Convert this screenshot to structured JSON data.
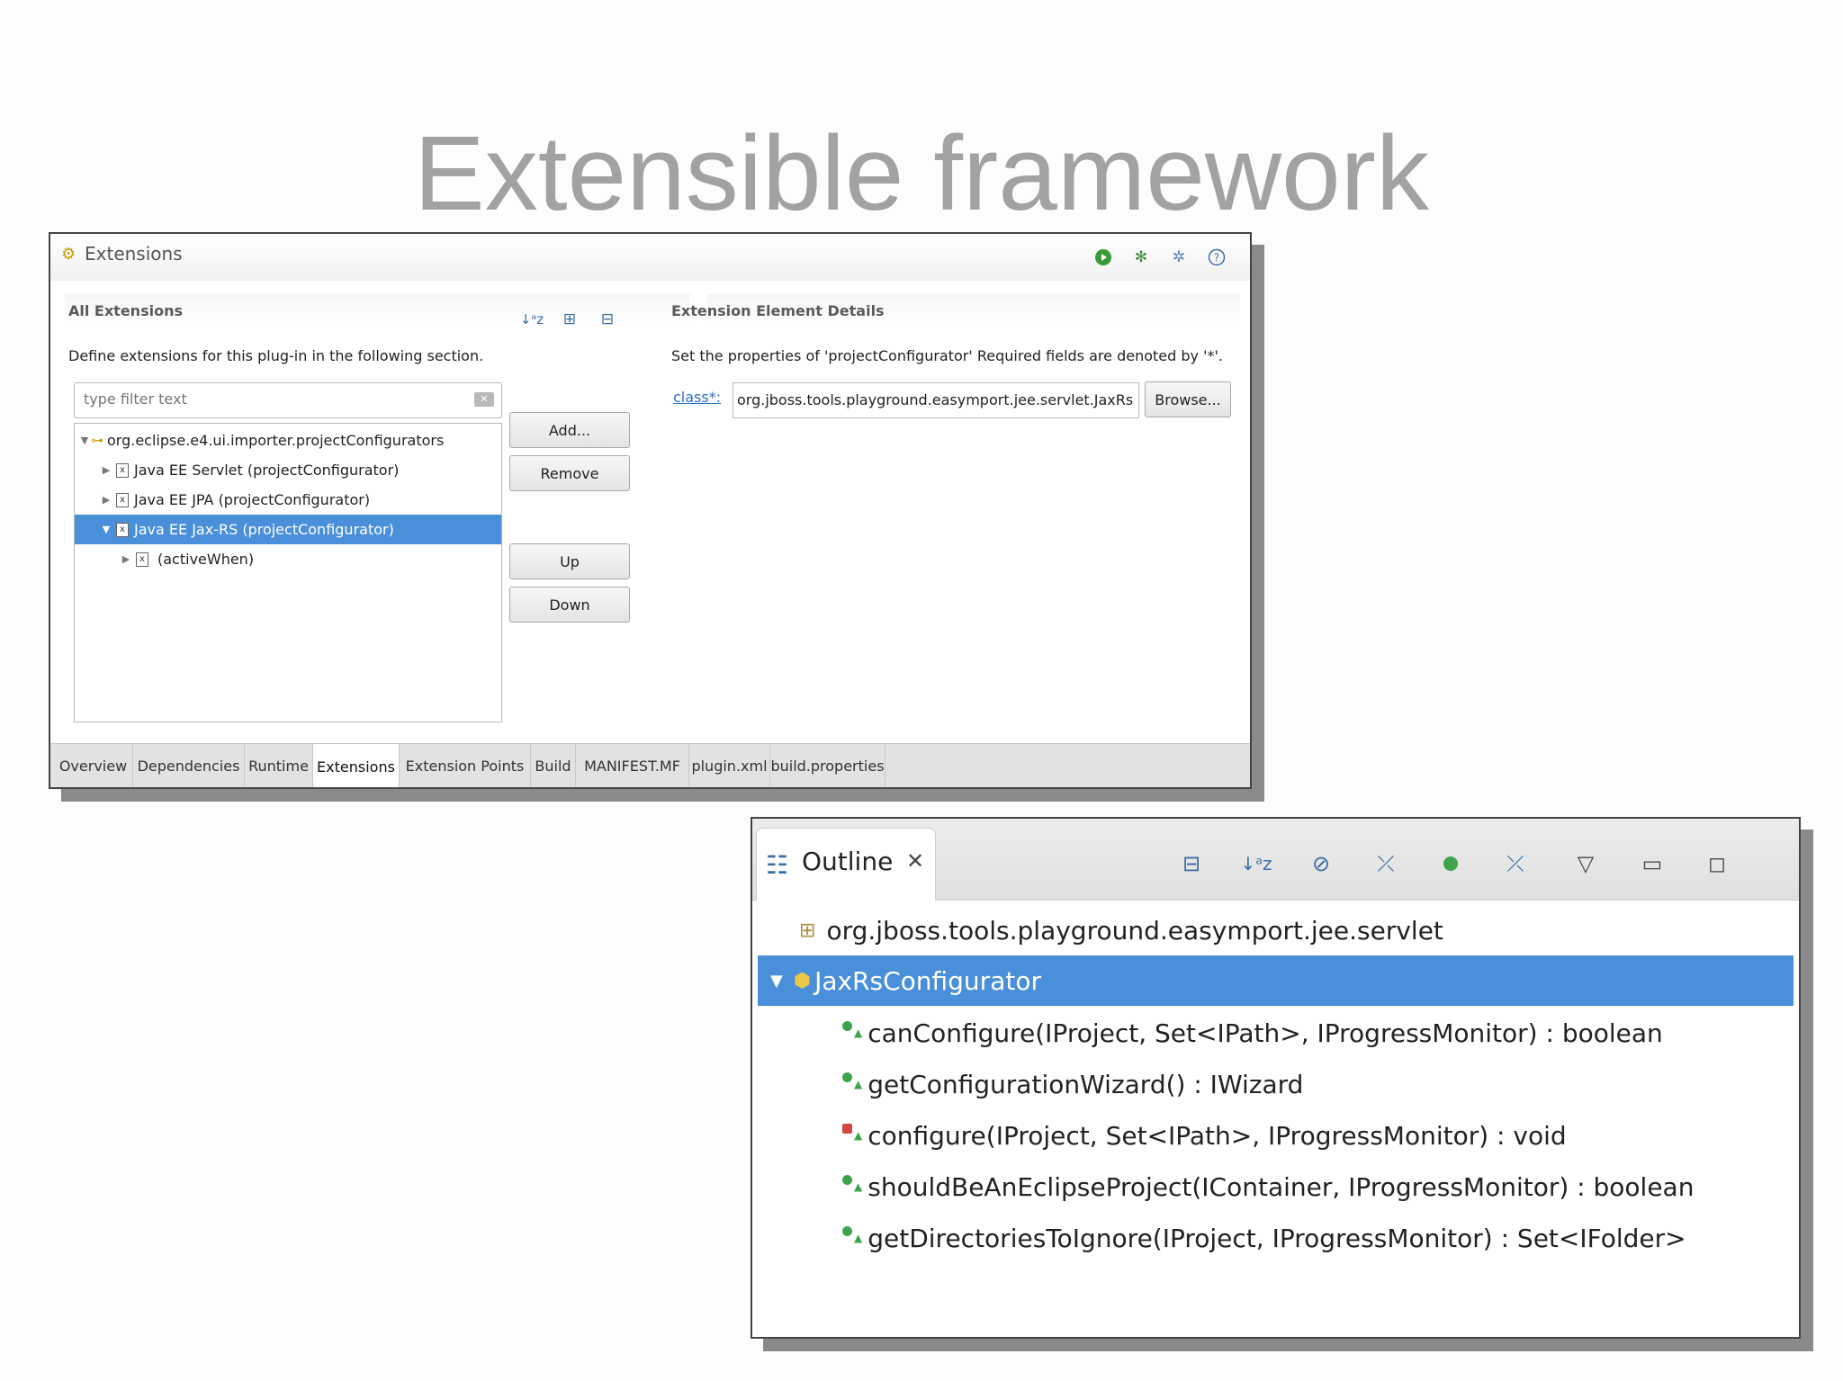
{
  "slide": {
    "title": "Extensible framework"
  },
  "extensions": {
    "title": "Extensions",
    "toolbar_icons": [
      "run-icon",
      "debug-icon",
      "plugin-icon",
      "help-icon"
    ],
    "all_extensions": {
      "title": "All Extensions",
      "description": "Define extensions for this plug-in in the following section.",
      "filter_placeholder": "type filter text",
      "tree": [
        {
          "label": "org.eclipse.e4.ui.importer.projectConfigurators",
          "level": 0,
          "expanded": true,
          "icon": "extension-point-icon"
        },
        {
          "label": "Java EE Servlet (projectConfigurator)",
          "level": 1,
          "expanded": false,
          "icon": "element-icon"
        },
        {
          "label": "Java EE JPA (projectConfigurator)",
          "level": 1,
          "expanded": false,
          "icon": "element-icon"
        },
        {
          "label": "Java EE Jax-RS (projectConfigurator)",
          "level": 1,
          "expanded": true,
          "selected": true,
          "icon": "element-icon"
        },
        {
          "label": "(activeWhen)",
          "level": 2,
          "expanded": false,
          "icon": "element-icon"
        }
      ],
      "buttons": {
        "add": "Add...",
        "remove": "Remove",
        "up": "Up",
        "down": "Down"
      }
    },
    "details": {
      "title": "Extension Element Details",
      "description": "Set the properties of 'projectConfigurator' Required fields are denoted by '*'.",
      "class_label": "class*:",
      "class_value": "org.jboss.tools.playground.easymport.jee.servlet.JaxRs",
      "browse": "Browse..."
    },
    "tabs": [
      "Overview",
      "Dependencies",
      "Runtime",
      "Extensions",
      "Extension Points",
      "Build",
      "MANIFEST.MF",
      "plugin.xml",
      "build.properties"
    ],
    "active_tab": "Extensions"
  },
  "outline": {
    "title": "Outline",
    "toolbar_icons": [
      "collapse-all-icon",
      "sort-icon",
      "hide-fields-icon",
      "hide-static-icon",
      "hide-nonpublic-icon",
      "hide-local-types-icon",
      "view-menu-icon",
      "minimize-icon",
      "maximize-icon"
    ],
    "package": "org.jboss.tools.playground.easymport.jee.servlet",
    "class": "JaxRsConfigurator",
    "methods": [
      {
        "label": "canConfigure(IProject, Set<IPath>, IProgressMonitor) : boolean",
        "status": "ok"
      },
      {
        "label": "getConfigurationWizard() : IWizard",
        "status": "ok"
      },
      {
        "label": "configure(IProject, Set<IPath>, IProgressMonitor) : void",
        "status": "error"
      },
      {
        "label": "shouldBeAnEclipseProject(IContainer, IProgressMonitor) : boolean",
        "status": "ok"
      },
      {
        "label": "getDirectoriesToIgnore(IProject, IProgressMonitor) : Set<IFolder>",
        "status": "ok"
      }
    ]
  },
  "colors": {
    "selection": "#4a8fd9",
    "title": "#a2a2a2",
    "link": "#2a6fc9",
    "method_ok": "#3fa34d",
    "method_error": "#d24646"
  }
}
